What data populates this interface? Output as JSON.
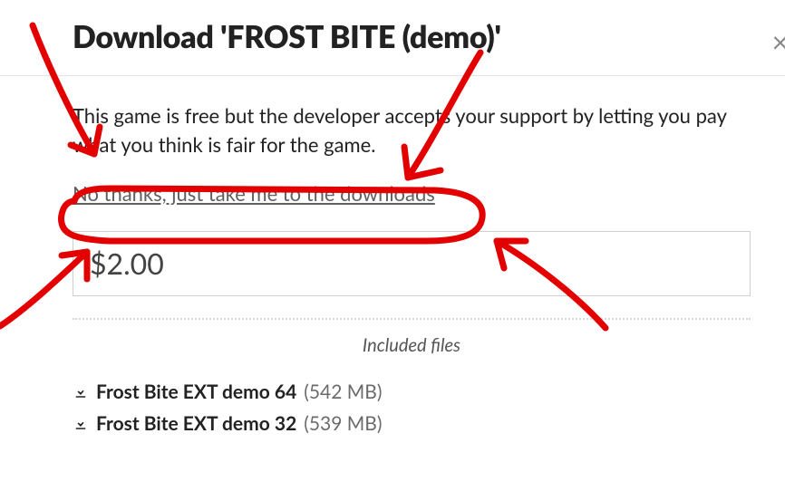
{
  "header": {
    "title": "Download 'FROST BITE (demo)'"
  },
  "intro_text": "This game is free but the developer accepts your support by letting you pay what you think is fair for the game.",
  "skip_link_text": "No thanks, just take me to the downloads",
  "price": {
    "value": "$2.00"
  },
  "included_label": "Included files",
  "files": [
    {
      "name": "Frost Bite EXT demo 64",
      "size": "(542 MB)"
    },
    {
      "name": "Frost Bite EXT demo 32",
      "size": "(539 MB)"
    }
  ],
  "close_glyph": "×"
}
